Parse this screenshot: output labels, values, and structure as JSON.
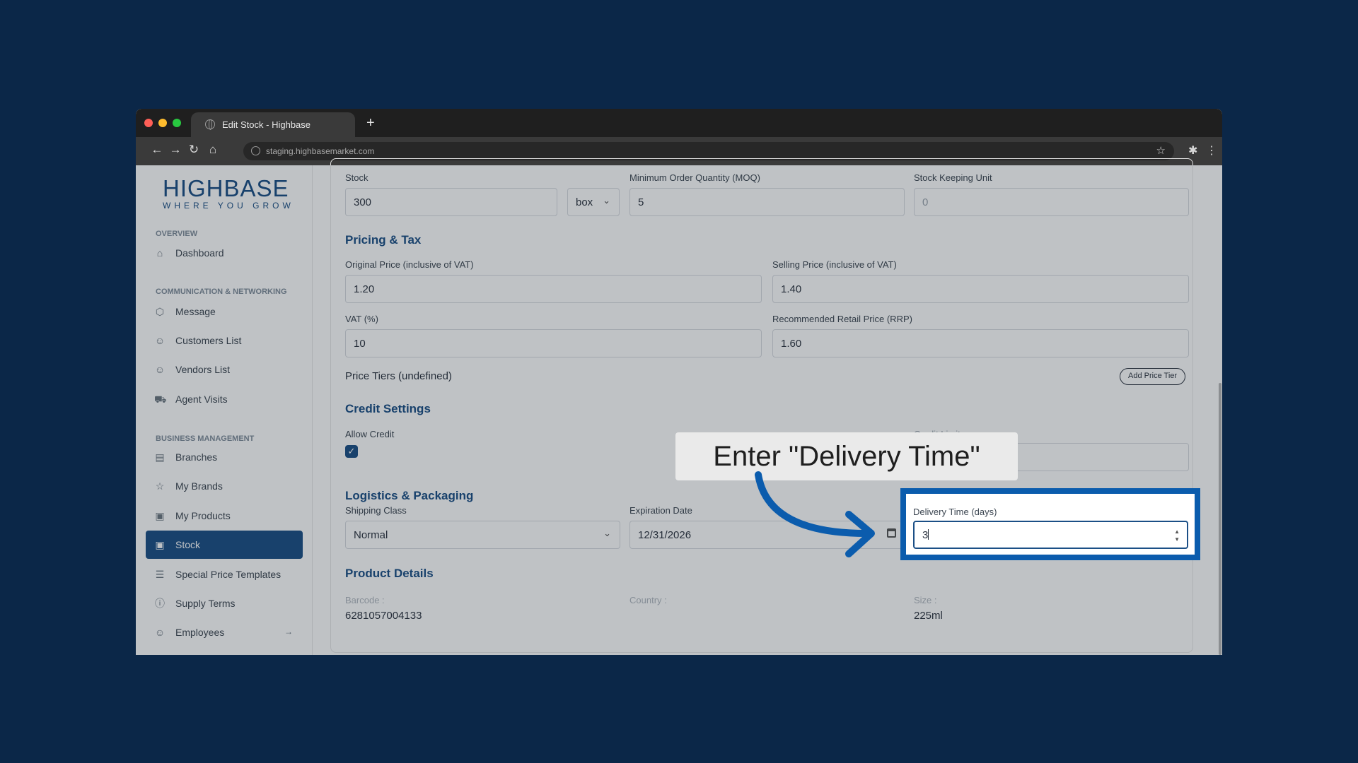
{
  "browser": {
    "tab_title": "Edit Stock - Highbase",
    "new_tab": "+",
    "url": "staging.highbasemarket.com"
  },
  "sidebar": {
    "logo_main": "HIGHBASE",
    "logo_sub": "WHERE YOU GROW",
    "sections": {
      "overview": "OVERVIEW",
      "communication": "COMMUNICATION & NETWORKING",
      "business": "BUSINESS MANAGEMENT"
    },
    "items": [
      {
        "label": "Dashboard",
        "icon": "home-icon"
      },
      {
        "label": "Message",
        "icon": "cube-icon"
      },
      {
        "label": "Customers List",
        "icon": "users-icon"
      },
      {
        "label": "Vendors List",
        "icon": "users-icon"
      },
      {
        "label": "Agent Visits",
        "icon": "truck-icon"
      },
      {
        "label": "Branches",
        "icon": "store-icon"
      },
      {
        "label": "My Brands",
        "icon": "star-icon"
      },
      {
        "label": "My Products",
        "icon": "archive-icon"
      },
      {
        "label": "Stock",
        "icon": "archive-icon",
        "active": true
      },
      {
        "label": "Special Price Templates",
        "icon": "list-icon"
      },
      {
        "label": "Supply Terms",
        "icon": "info-icon"
      },
      {
        "label": "Employees",
        "icon": "users-icon"
      }
    ]
  },
  "form": {
    "stock_label": "Stock",
    "stock_value": "300",
    "unit_value": "box",
    "moq_label": "Minimum Order Quantity (MOQ)",
    "moq_value": "5",
    "sku_label": "Stock Keeping Unit",
    "sku_placeholder": "0",
    "pricing_heading": "Pricing & Tax",
    "original_price_label": "Original Price (inclusive of VAT)",
    "original_price_value": "1.20",
    "selling_price_label": "Selling Price (inclusive of VAT)",
    "selling_price_value": "1.40",
    "vat_label": "VAT (%)",
    "vat_value": "10",
    "rrp_label": "Recommended Retail Price (RRP)",
    "rrp_value": "1.60",
    "price_tiers": "Price Tiers (undefined)",
    "add_price_tier": "Add Price Tier",
    "credit_heading": "Credit Settings",
    "allow_credit_label": "Allow Credit",
    "credit_limit_label": "Credit Limit",
    "logistics_heading": "Logistics & Packaging",
    "shipping_class_label": "Shipping Class",
    "shipping_class_value": "Normal",
    "expiration_label": "Expiration Date",
    "expiration_value": "12/31/2026",
    "delivery_label": "Delivery Time (days)",
    "delivery_value": "3",
    "details_heading": "Product Details",
    "barcode_label": "Barcode :",
    "barcode_value": "6281057004133",
    "country_label": "Country :",
    "size_label": "Size :",
    "size_value": "225ml"
  },
  "callout": {
    "text": "Enter \"Delivery Time\"",
    "arrow_color": "#0b5cad"
  }
}
